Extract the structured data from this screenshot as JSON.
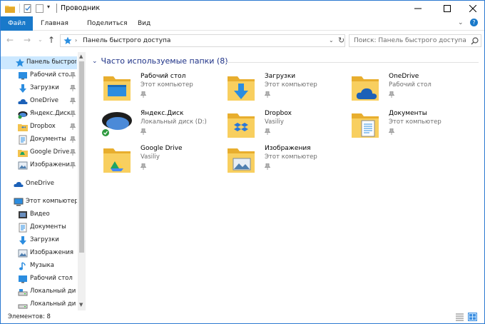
{
  "window": {
    "title": "Проводник",
    "buttons": {
      "minimize": "minimize",
      "maximize": "maximize",
      "close": "close"
    }
  },
  "ribbon": {
    "tabs": [
      "Файл",
      "Главная",
      "Поделиться",
      "Вид"
    ],
    "expand_glyph": "⌄",
    "help_glyph": "?"
  },
  "address": {
    "path": "Панель быстрого доступа",
    "search_placeholder": "Поиск: Панель быстрого доступа"
  },
  "sidebar": {
    "quick_access": {
      "label": "Панель быстрого доступа",
      "items": [
        {
          "label": "Рабочий стол",
          "icon": "desktop-icon",
          "pinned": true
        },
        {
          "label": "Загрузки",
          "icon": "download-icon",
          "pinned": true
        },
        {
          "label": "OneDrive",
          "icon": "onedrive-icon",
          "pinned": true
        },
        {
          "label": "Яндекс.Диск",
          "icon": "yandex-disk-icon",
          "pinned": true
        },
        {
          "label": "Dropbox",
          "icon": "dropbox-folder-icon",
          "pinned": true
        },
        {
          "label": "Документы",
          "icon": "documents-icon",
          "pinned": true
        },
        {
          "label": "Google Drive",
          "icon": "google-drive-icon",
          "pinned": true
        },
        {
          "label": "Изображения",
          "icon": "pictures-icon",
          "pinned": true
        }
      ]
    },
    "onedrive": {
      "label": "OneDrive"
    },
    "this_pc": {
      "label": "Этот компьютер",
      "items": [
        {
          "label": "Видео",
          "icon": "video-icon"
        },
        {
          "label": "Документы",
          "icon": "documents-icon"
        },
        {
          "label": "Загрузки",
          "icon": "download-icon"
        },
        {
          "label": "Изображения",
          "icon": "pictures-icon"
        },
        {
          "label": "Музыка",
          "icon": "music-icon"
        },
        {
          "label": "Рабочий стол",
          "icon": "desktop-icon"
        },
        {
          "label": "Локальный диск",
          "icon": "drive-icon"
        },
        {
          "label": "Локальный диск",
          "icon": "drive-icon"
        }
      ]
    }
  },
  "main": {
    "group_title": "Часто используемые папки (8)",
    "folders": [
      {
        "name": "Рабочий стол",
        "sub": "Этот компьютер",
        "icon": "desktop-folder-icon"
      },
      {
        "name": "Загрузки",
        "sub": "Этот компьютер",
        "icon": "downloads-folder-icon"
      },
      {
        "name": "OneDrive",
        "sub": "Рабочий стол",
        "icon": "onedrive-folder-icon"
      },
      {
        "name": "Яндекс.Диск",
        "sub": "Локальный диск (D:)",
        "icon": "yandex-disk-icon"
      },
      {
        "name": "Dropbox",
        "sub": "Vasiliy",
        "icon": "dropbox-folder-icon"
      },
      {
        "name": "Документы",
        "sub": "Этот компьютер",
        "icon": "documents-folder-icon"
      },
      {
        "name": "Google Drive",
        "sub": "Vasiliy",
        "icon": "google-drive-folder-icon"
      },
      {
        "name": "Изображения",
        "sub": "Этот компьютер",
        "icon": "pictures-folder-icon"
      }
    ]
  },
  "status": {
    "item_count": "Элементов: 8"
  },
  "colors": {
    "accent": "#1979ca",
    "selection": "#cce8ff",
    "folder": "#f3c34f",
    "group_title": "#1e3287"
  }
}
